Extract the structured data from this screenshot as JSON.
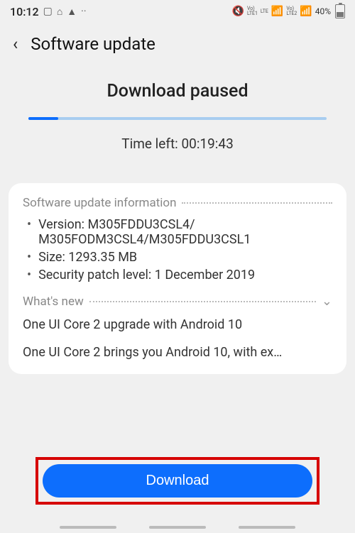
{
  "status": {
    "time": "10:12",
    "battery_text": "40%",
    "sim1": "Vo)\nLTE1",
    "net1": "LTE",
    "sim2": "Vo)\nLTE2"
  },
  "header": {
    "title": "Software update"
  },
  "progress": {
    "status_text": "Download paused",
    "percent": 10,
    "time_left": "Time left: 00:19:43"
  },
  "info": {
    "section_label": "Software update information",
    "version_label": "Version: M305FDDU3CSL4/ M305FODM3CSL4/M305FDDU3CSL1",
    "size_label": "Size: 1293.35 MB",
    "patch_label": "Security patch level: 1 December 2019"
  },
  "whatsnew": {
    "section_label": "What's new",
    "headline": "One UI Core 2 upgrade with Android 10",
    "body": "One UI Core 2 brings you Android 10, with ex…"
  },
  "actions": {
    "download_label": "Download"
  }
}
